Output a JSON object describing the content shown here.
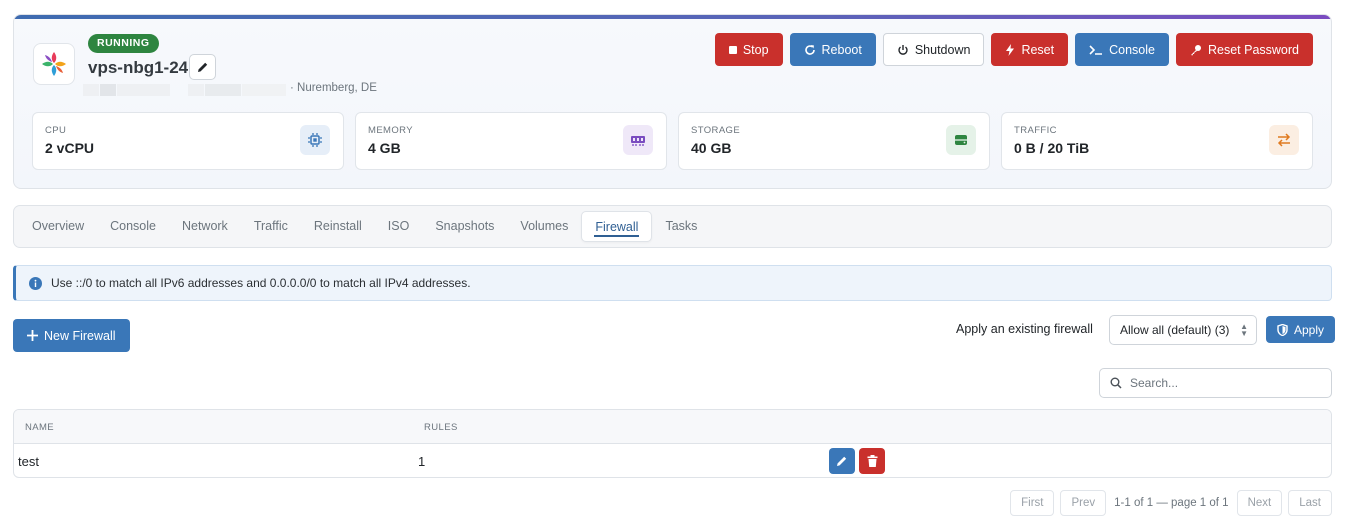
{
  "server": {
    "status": "RUNNING",
    "name": "vps-nbg1-24",
    "location": "· Nuremberg, DE"
  },
  "actions": {
    "stop": "Stop",
    "reboot": "Reboot",
    "shutdown": "Shutdown",
    "reset": "Reset",
    "console": "Console",
    "reset_password": "Reset Password"
  },
  "stats": [
    {
      "label": "CPU",
      "value": "2 vCPU",
      "icon": "cpu-icon",
      "color": "#3a77b8"
    },
    {
      "label": "MEMORY",
      "value": "4 GB",
      "icon": "memory-icon",
      "color": "#7a4cc0"
    },
    {
      "label": "STORAGE",
      "value": "40 GB",
      "icon": "storage-icon",
      "color": "#2e8540"
    },
    {
      "label": "TRAFFIC",
      "value": "0 B / 20 TiB",
      "icon": "traffic-icon",
      "color": "#e07a1f"
    }
  ],
  "tabs": [
    "Overview",
    "Console",
    "Network",
    "Traffic",
    "Reinstall",
    "ISO",
    "Snapshots",
    "Volumes",
    "Firewall",
    "Tasks"
  ],
  "active_tab": "Firewall",
  "alert": "Use ::/0 to match all IPv6 addresses and 0.0.0.0/0 to match all IPv4 addresses.",
  "firewall": {
    "new_button": "New Firewall",
    "apply_label": "Apply an existing firewall",
    "apply_selected": "Allow all (default) (3)",
    "apply_button": "Apply",
    "search_placeholder": "Search..."
  },
  "table": {
    "headers": [
      "NAME",
      "RULES"
    ],
    "rows": [
      {
        "name": "test",
        "rules": "1"
      }
    ]
  },
  "pagination": {
    "first": "First",
    "prev": "Prev",
    "info": "1-1 of 1 — page 1 of 1",
    "next": "Next",
    "last": "Last"
  },
  "colors": {
    "danger": "#c9302c",
    "primary": "#3a77b8",
    "success": "#2e8540"
  }
}
